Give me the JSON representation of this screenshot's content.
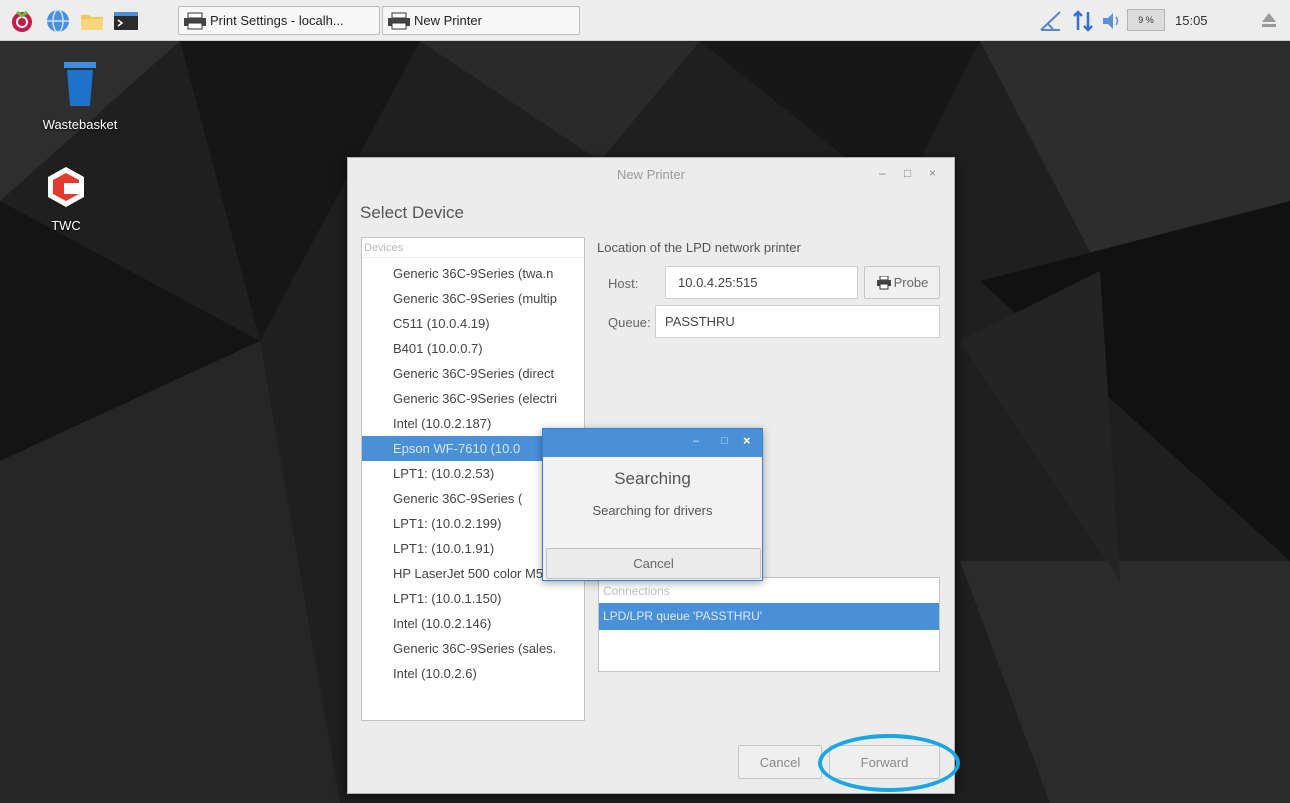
{
  "taskbar": {
    "tasks": [
      {
        "label": "Print Settings - localh..."
      },
      {
        "label": "New Printer"
      }
    ],
    "cpu_label": "9 %",
    "clock": "15:05"
  },
  "desktop": {
    "icons": [
      {
        "label": "Wastebasket"
      },
      {
        "label": "TWC"
      }
    ]
  },
  "dialog": {
    "title": "New Printer",
    "controls": {
      "minimize": "–",
      "maximize": "□",
      "close": "×"
    },
    "select_device": "Select Device",
    "devices_header": "Devices",
    "devices": [
      "Generic 36C-9Series (twa.n",
      "Generic 36C-9Series (multip",
      "C511  (10.0.4.19)",
      "B401  (10.0.0.7)",
      "Generic 36C-9Series (direct",
      "Generic 36C-9Series (electri",
      "Intel (10.0.2.187)",
      "Epson WF-7610 (10.0",
      "LPT1: (10.0.2.53)",
      "Generic 36C-9Series (",
      "LPT1: (10.0.2.199)",
      "LPT1: (10.0.1.91)",
      "HP LaserJet 500 color M55",
      "LPT1: (10.0.1.150)",
      "Intel (10.0.2.146)",
      "Generic 36C-9Series (sales.",
      "Intel (10.0.2.6)"
    ],
    "selected_device": "Epson WF-7610 (10.0",
    "lpd_label": "Location of the LPD network printer",
    "host_label": "Host:",
    "host_value": "10.0.4.25:515",
    "probe_label": "Probe",
    "queue_label": "Queue:",
    "queue_value": "PASSTHRU",
    "connections_header": "Connections",
    "connection_selected": "LPD/LPR queue 'PASSTHRU'",
    "cancel_label": "Cancel",
    "forward_label": "Forward"
  },
  "searching": {
    "title": "Searching",
    "message": "Searching for drivers",
    "cancel_label": "Cancel"
  },
  "colors": {
    "selection": "#4a90d9",
    "highlight_ring": "#1aa5e6"
  }
}
